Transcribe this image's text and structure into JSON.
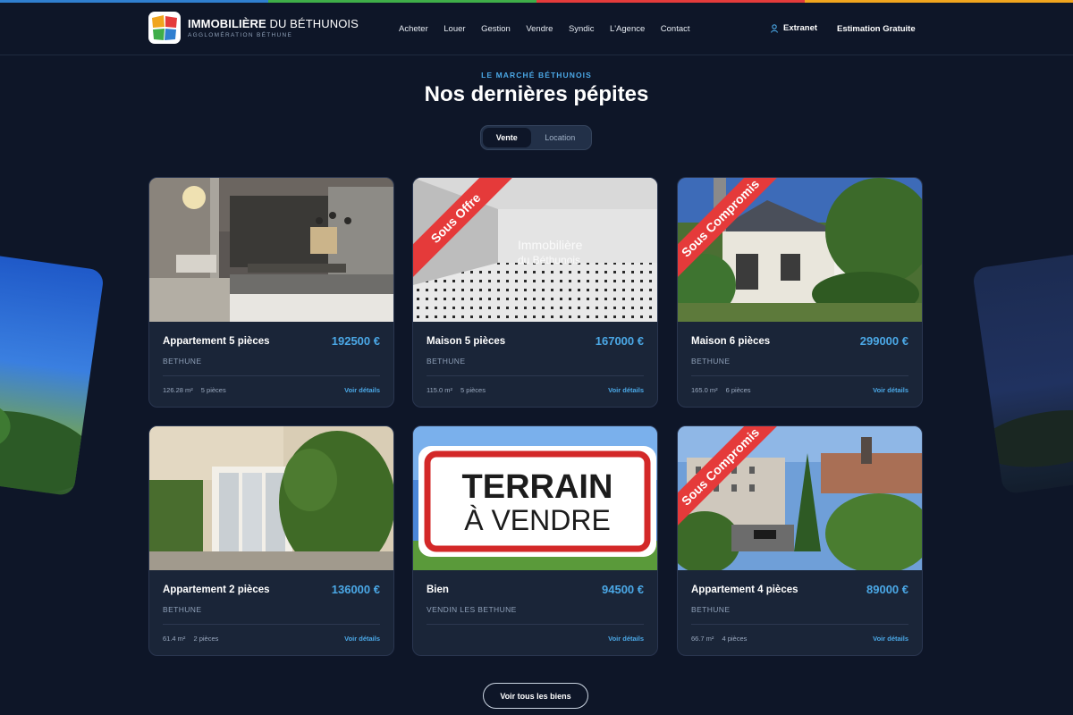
{
  "brand": {
    "title_bold": "IMMOBILIÈRE",
    "title_rest": " DU BÉTHUNOIS",
    "subtitle": "AGGLOMÉRATION BÉTHUNE",
    "top_strip_colors": [
      "#2f7fd0",
      "#3fae49",
      "#e43b3b",
      "#f0a51e"
    ]
  },
  "nav": {
    "items": [
      "Acheter",
      "Louer",
      "Gestion",
      "Vendre",
      "Syndic",
      "L'Agence",
      "Contact"
    ],
    "extranet_label": "Extranet",
    "estimation_label": "Estimation Gratuite"
  },
  "section": {
    "eyebrow": "LE MARCHÉ BÉTHUNOIS",
    "title": "Nos dernières pépites",
    "toggle": {
      "active": "Vente",
      "inactive": "Location"
    }
  },
  "accent_color": "#4ba8e6",
  "listings": [
    {
      "title": "Appartement 5 pièces",
      "price": "192500 €",
      "city": "BETHUNE",
      "area": "126.28 m²",
      "rooms": "5 pièces",
      "details": "Voir détails",
      "ribbon": "",
      "image": "interior-kitchen"
    },
    {
      "title": "Maison 5 pièces",
      "price": "167000 €",
      "city": "BETHUNE",
      "area": "115.0 m²",
      "rooms": "5 pièces",
      "details": "Voir détails",
      "ribbon": "Sous Offre",
      "image": "empty-room-tiled-floor",
      "watermark_line1": "Immobilière",
      "watermark_line2": "du Béthunois"
    },
    {
      "title": "Maison 6 pièces",
      "price": "299000 €",
      "city": "BETHUNE",
      "area": "165.0 m²",
      "rooms": "6 pièces",
      "details": "Voir détails",
      "ribbon": "Sous Compromis",
      "image": "house-garden"
    },
    {
      "title": "Appartement 2 pièces",
      "price": "136000 €",
      "city": "BETHUNE",
      "area": "61.4 m²",
      "rooms": "2 pièces",
      "details": "Voir détails",
      "ribbon": "",
      "image": "patio-hedge"
    },
    {
      "title": "Bien",
      "price": "94500 €",
      "city": "VENDIN LES BETHUNE",
      "area": "",
      "rooms": "",
      "details": "Voir détails",
      "ribbon": "",
      "image": "terrain-sign",
      "sign_line1": "TERRAIN",
      "sign_line2": "À VENDRE"
    },
    {
      "title": "Appartement 4 pièces",
      "price": "89000 €",
      "city": "BETHUNE",
      "area": "66.7 m²",
      "rooms": "4 pièces",
      "details": "Voir détails",
      "ribbon": "Sous Compromis",
      "image": "apartment-buildings"
    }
  ],
  "cta": {
    "all_label": "Voir tous les biens"
  }
}
